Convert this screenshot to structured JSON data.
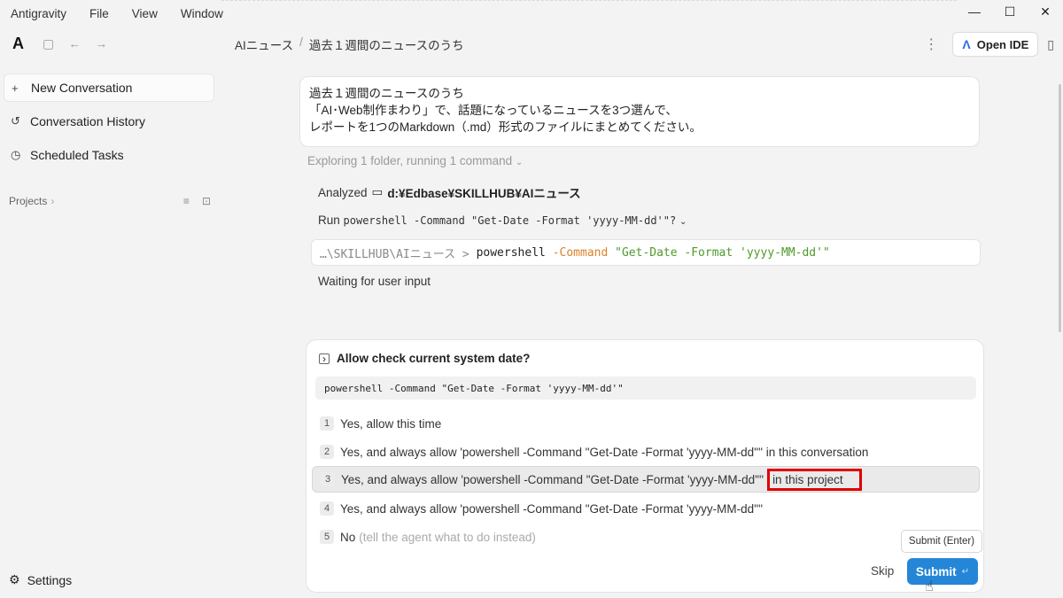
{
  "menu": [
    "Antigravity",
    "File",
    "View",
    "Window"
  ],
  "window_controls": {
    "minimize": "—",
    "maximize": "☐",
    "close": "✕"
  },
  "sidebar": {
    "logo": "A",
    "items": [
      {
        "icon": "plus-icon",
        "glyph": "+",
        "label": "New Conversation"
      },
      {
        "icon": "history-icon",
        "glyph": "↺",
        "label": "Conversation History"
      },
      {
        "icon": "clock-icon",
        "glyph": "◷",
        "label": "Scheduled Tasks"
      }
    ],
    "projects_label": "Projects",
    "settings_label": "Settings"
  },
  "header": {
    "breadcrumb": [
      "AIニュース",
      "過去１週間のニュースのうち"
    ],
    "open_ide_label": "Open IDE"
  },
  "prompt": {
    "lines": [
      "過去１週間のニュースのうち",
      "「AI･Web制作まわり」で、話題になっているニュースを3つ選んで、",
      "レポートを1つのMarkdown（.md）形式のファイルにまとめてください。"
    ]
  },
  "activity": {
    "exploring": "Exploring 1 folder, running 1 command",
    "analyzed_label": "Analyzed",
    "analyzed_path": "d:¥Edbase¥SKILLHUB¥AIニュース",
    "run_label": "Run",
    "run_command": "powershell -Command \"Get-Date -Format 'yyyy-MM-dd'\"?",
    "terminal": {
      "cwd": "…\\SKILLHUB\\AIニュース >",
      "cmd": "powershell",
      "flag": "-Command",
      "arg": "\"Get-Date -Format 'yyyy-MM-dd'\""
    },
    "waiting": "Waiting for user input"
  },
  "approval": {
    "title": "Allow check current system date?",
    "command": "powershell -Command \"Get-Date -Format 'yyyy-MM-dd'\"",
    "options": [
      {
        "num": "1",
        "label": "Yes, allow this time"
      },
      {
        "num": "2",
        "label": "Yes, and always allow 'powershell -Command \"Get-Date -Format 'yyyy-MM-dd'\"' in this conversation"
      },
      {
        "num": "3",
        "label": "Yes, and always allow 'powershell -Command \"Get-Date -Format 'yyyy-MM-dd'\"'",
        "highlight": "in this project"
      },
      {
        "num": "4",
        "label": "Yes, and always allow 'powershell -Command \"Get-Date -Format 'yyyy-MM-dd'\"'"
      },
      {
        "num": "5",
        "label": "No",
        "hint": "(tell the agent what to do instead)"
      }
    ],
    "tooltip": "Submit (Enter)",
    "skip_label": "Skip",
    "submit_label": "Submit",
    "submit_key": "↵"
  },
  "colors": {
    "accent": "#2586d8",
    "highlight_border": "#e00000"
  }
}
